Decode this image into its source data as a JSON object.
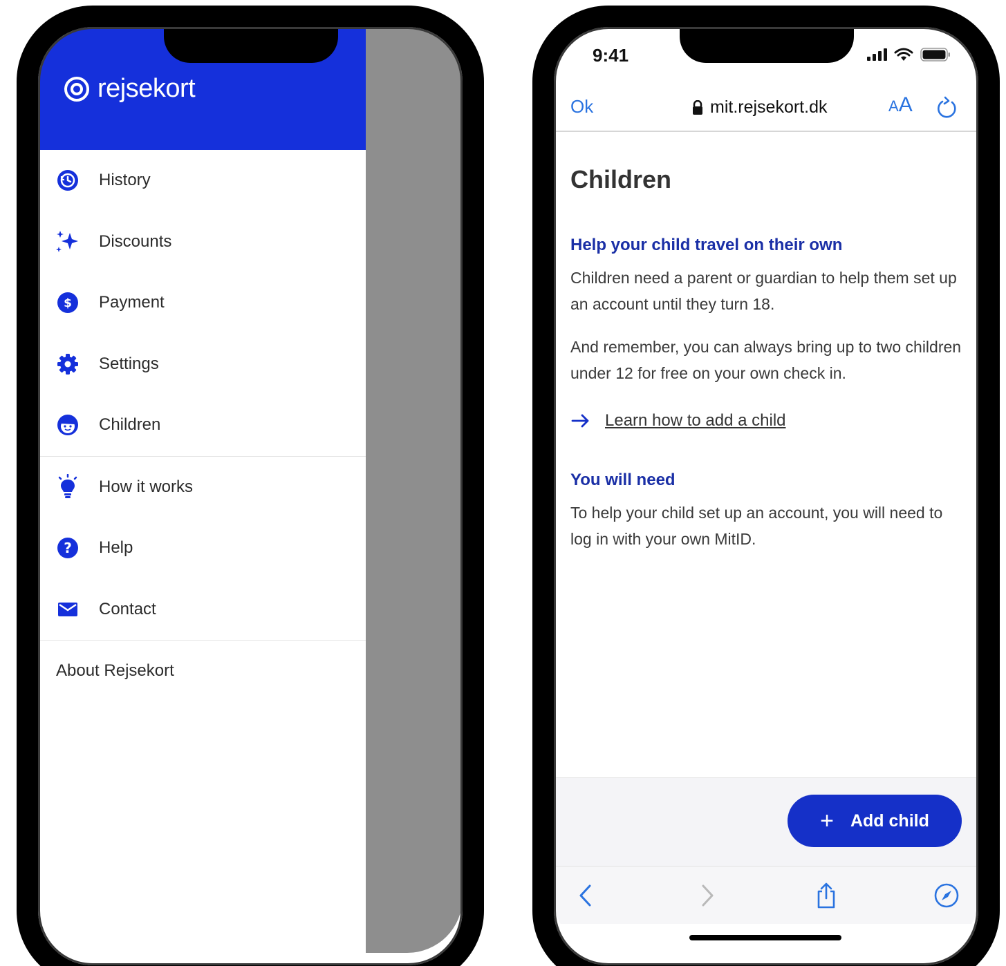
{
  "left_phone": {
    "brand": {
      "name": "rejsekort",
      "color": "#1530db"
    },
    "menu": [
      {
        "label": "History",
        "icon": "history-icon"
      },
      {
        "label": "Discounts",
        "icon": "sparkle-icon"
      },
      {
        "label": "Payment",
        "icon": "dollar-icon"
      },
      {
        "label": "Settings",
        "icon": "gear-icon"
      },
      {
        "label": "Children",
        "icon": "child-face-icon"
      },
      {
        "label": "How it works",
        "icon": "lightbulb-icon"
      },
      {
        "label": "Help",
        "icon": "question-icon"
      },
      {
        "label": "Contact",
        "icon": "mail-icon"
      }
    ],
    "about": "About Rejsekort"
  },
  "right_phone": {
    "status": {
      "time": "9:41"
    },
    "browser": {
      "ok": "Ok",
      "url": "mit.rejsekort.dk",
      "aa_small": "A",
      "aa_big": "A"
    },
    "page": {
      "title": "Children",
      "section1": {
        "heading": "Help your child travel on their own",
        "p1": "Children need a parent or guardian to help them set up an account until they turn 18.",
        "p2": "And remember, you can always bring up to two children under 12 for free on your own check in.",
        "link": "Learn how to add a child"
      },
      "section2": {
        "heading": "You will need",
        "p1": "To help your child set up an account, you will need to log in with your own MitID."
      }
    },
    "footer": {
      "button_label": "Add child",
      "button_icon": "plus-icon"
    }
  },
  "colors": {
    "brand_blue": "#1530db",
    "heading_blue": "#1a2fa6",
    "link_blue": "#2a73e0",
    "overlay": "#8e8e8e"
  }
}
